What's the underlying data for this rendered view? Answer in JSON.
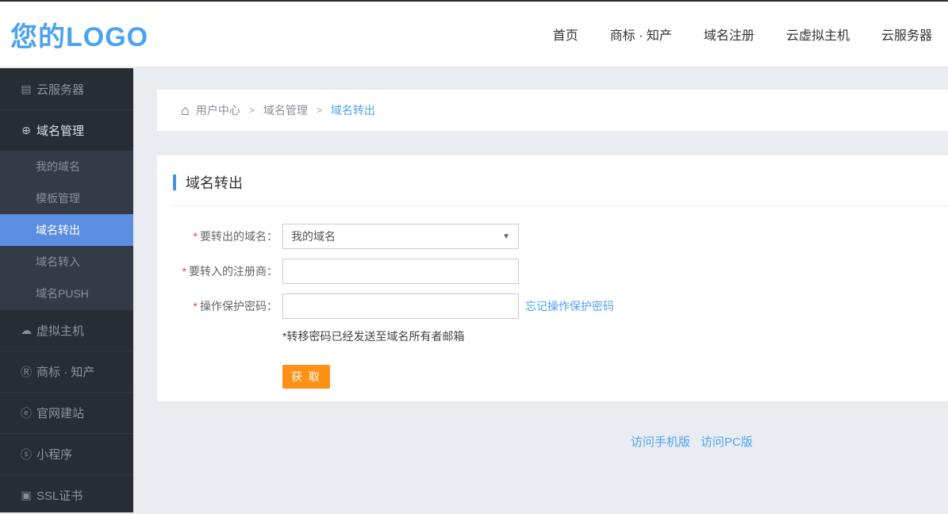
{
  "colors": {
    "accent": "#4a90e2",
    "active_blue": "#5b8de1",
    "orange": "#ff9016",
    "link_blue": "#4da3f7",
    "logo_blue": "#4aa3ef"
  },
  "header": {
    "logo": "您的LOGO",
    "nav": [
      {
        "label": "首页"
      },
      {
        "label": "商标 · 知产"
      },
      {
        "label": "域名注册"
      },
      {
        "label": "云虚拟主机"
      },
      {
        "label": "云服务器"
      }
    ]
  },
  "sidebar": {
    "items": [
      {
        "label": "云服务器",
        "icon": "server-icon",
        "glyph": "▤"
      },
      {
        "label": "域名管理",
        "icon": "globe-icon",
        "glyph": "⊕"
      },
      {
        "label": "虚拟主机",
        "icon": "host-icon",
        "glyph": "☁"
      },
      {
        "label": "商标 · 知产",
        "icon": "trademark-icon",
        "glyph": "Ⓡ"
      },
      {
        "label": "官网建站",
        "icon": "website-icon",
        "glyph": "ⓔ"
      },
      {
        "label": "小程序",
        "icon": "miniapp-icon",
        "glyph": "ⓢ"
      },
      {
        "label": "SSL证书",
        "icon": "certificate-icon",
        "glyph": "▣"
      }
    ],
    "submenu": {
      "parent": "域名管理",
      "items": [
        "我的域名",
        "模板管理",
        "域名转出",
        "域名转入",
        "域名PUSH"
      ],
      "active": "域名转出"
    }
  },
  "breadcrumb": {
    "home_icon": "⌂",
    "separator": ">",
    "items": [
      "用户中心",
      "域名管理",
      "域名转出"
    ]
  },
  "page": {
    "title": "域名转出",
    "form": {
      "required_mark": "*",
      "fields": [
        {
          "label": "要转出的域名：",
          "type": "select",
          "value": "我的域名",
          "caret": "▼"
        },
        {
          "label": "要转入的注册商：",
          "type": "input",
          "value": ""
        },
        {
          "label": "操作保护密码：",
          "type": "input",
          "value": "",
          "link": "忘记操作保护密码"
        }
      ],
      "note": "*转移密码已经发送至域名所有者邮箱",
      "submit_label": "获 取"
    }
  },
  "footer": {
    "links": [
      "访问手机版",
      "访问PC版"
    ]
  }
}
